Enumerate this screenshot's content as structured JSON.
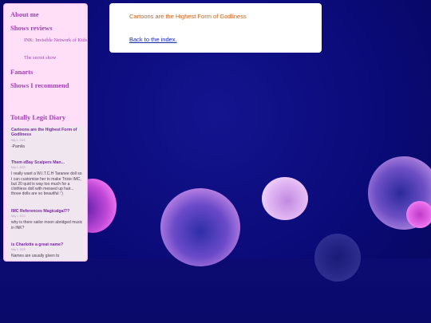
{
  "nav": {
    "about": "About me",
    "shows_reviews": "Shows reviews",
    "sub_items": [
      "INK: Invisible Network of Kids",
      "The secret show"
    ],
    "fanarts": "Fanarts",
    "shows_recommend": "Shows I recommend"
  },
  "diary": {
    "title": "Totally Legit Diary",
    "posts": [
      {
        "title": "Cartoons are the Highest Form of Godliness",
        "date": "May 1, 2023",
        "body": "-Pamila"
      },
      {
        "title": "Them eBay Scalpers Man...",
        "date": "May 1, 2023",
        "body": "I really want a W.I.T.C.H Taranee doll so I can customise her to make Trixie IMC, but 20 quid is way too much for a clothless doll with messed up hair... those dolls are so beautiful :')"
      },
      {
        "title": "IMC References Magicalgal??",
        "date": "May 1, 2023",
        "body": "why is there sailor moon abridged music in INK?"
      },
      {
        "title": "is Charlotte a great name?",
        "date": "May 1, 2023",
        "body": "Names are usually given to"
      }
    ]
  },
  "content": {
    "title": "Cartoons are the Highest Form of Godliness",
    "back_link": "Back to the index."
  },
  "colors": {
    "background": "#0a0a78",
    "sidebar": "#ffdff8",
    "nav_text": "#a140b4",
    "post_title": "#c4621e",
    "link": "#1a2ab4"
  }
}
